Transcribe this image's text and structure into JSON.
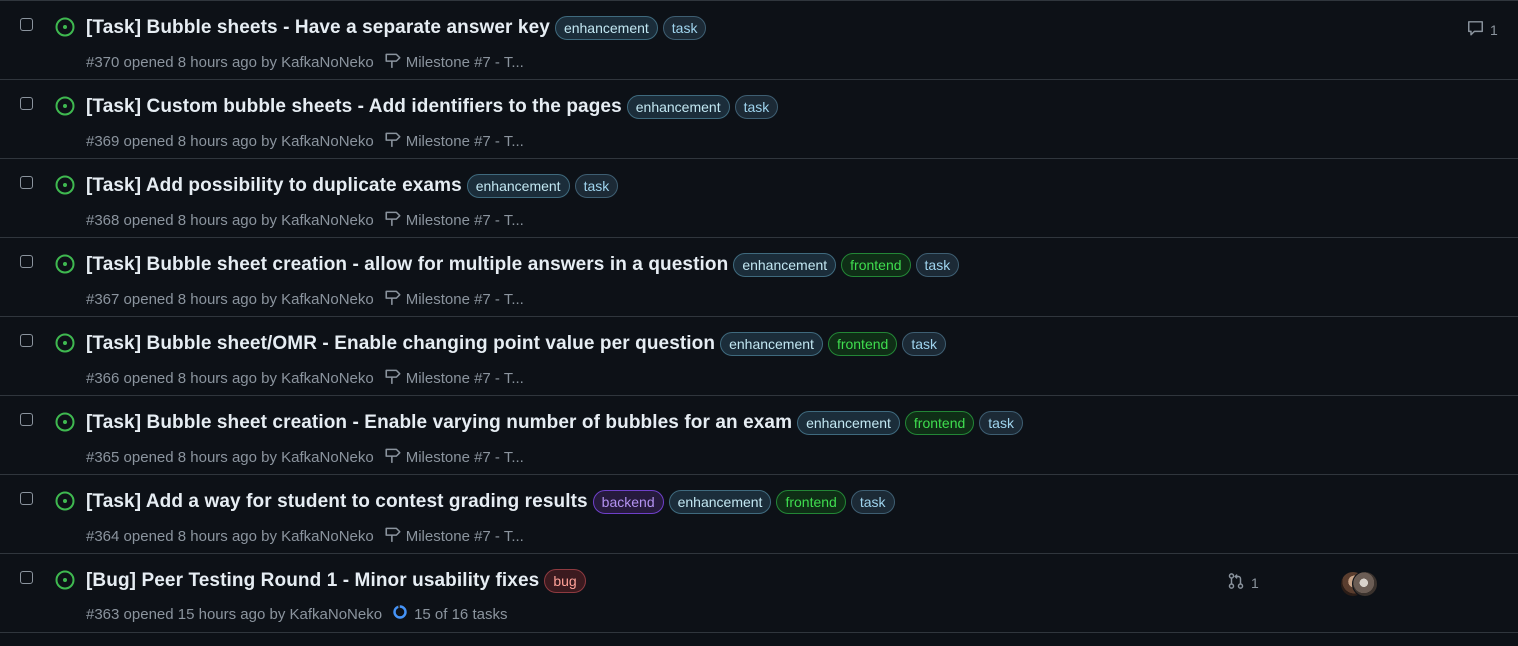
{
  "issues": [
    {
      "title": "[Task] Bubble sheets - Have a separate answer key",
      "labels": [
        "enhancement",
        "task"
      ],
      "meta": "#370 opened 8 hours ago by KafkaNoNeko",
      "milestone": "Milestone #7 - T...",
      "comments": "1"
    },
    {
      "title": "[Task] Custom bubble sheets - Add identifiers to the pages",
      "labels": [
        "enhancement",
        "task"
      ],
      "meta": "#369 opened 8 hours ago by KafkaNoNeko",
      "milestone": "Milestone #7 - T..."
    },
    {
      "title": "[Task] Add possibility to duplicate exams",
      "labels": [
        "enhancement",
        "task"
      ],
      "meta": "#368 opened 8 hours ago by KafkaNoNeko",
      "milestone": "Milestone #7 - T..."
    },
    {
      "title": "[Task] Bubble sheet creation - allow for multiple answers in a question",
      "labels": [
        "enhancement",
        "frontend",
        "task"
      ],
      "meta": "#367 opened 8 hours ago by KafkaNoNeko",
      "milestone": "Milestone #7 - T..."
    },
    {
      "title": "[Task] Bubble sheet/OMR - Enable changing point value per question",
      "labels": [
        "enhancement",
        "frontend",
        "task"
      ],
      "meta": "#366 opened 8 hours ago by KafkaNoNeko",
      "milestone": "Milestone #7 - T..."
    },
    {
      "title": "[Task] Bubble sheet creation - Enable varying number of bubbles for an exam",
      "labels": [
        "enhancement",
        "frontend",
        "task"
      ],
      "meta": "#365 opened 8 hours ago by KafkaNoNeko",
      "milestone": "Milestone #7 - T..."
    },
    {
      "title": "[Task] Add a way for student to contest grading results",
      "labels": [
        "backend",
        "enhancement",
        "frontend",
        "task"
      ],
      "meta": "#364 opened 8 hours ago by KafkaNoNeko",
      "milestone": "Milestone #7 - T..."
    },
    {
      "title": "[Bug] Peer Testing Round 1 - Minor usability fixes",
      "labels": [
        "bug"
      ],
      "meta": "#363 opened 15 hours ago by KafkaNoNeko",
      "tasks": "15 of 16 tasks",
      "tasks_fraction": 0.9375,
      "linked_prs": "1",
      "has_avatars": true
    }
  ],
  "icons": {
    "status": "issue-opened-icon",
    "milestone": "milestone-icon",
    "comment": "comment-icon",
    "pull_request": "git-pull-request-icon",
    "tasks": "task-progress-icon"
  },
  "colors": {
    "open": "#3fb950",
    "background": "#0d1117",
    "border": "#30363d",
    "muted": "#8b949e"
  }
}
